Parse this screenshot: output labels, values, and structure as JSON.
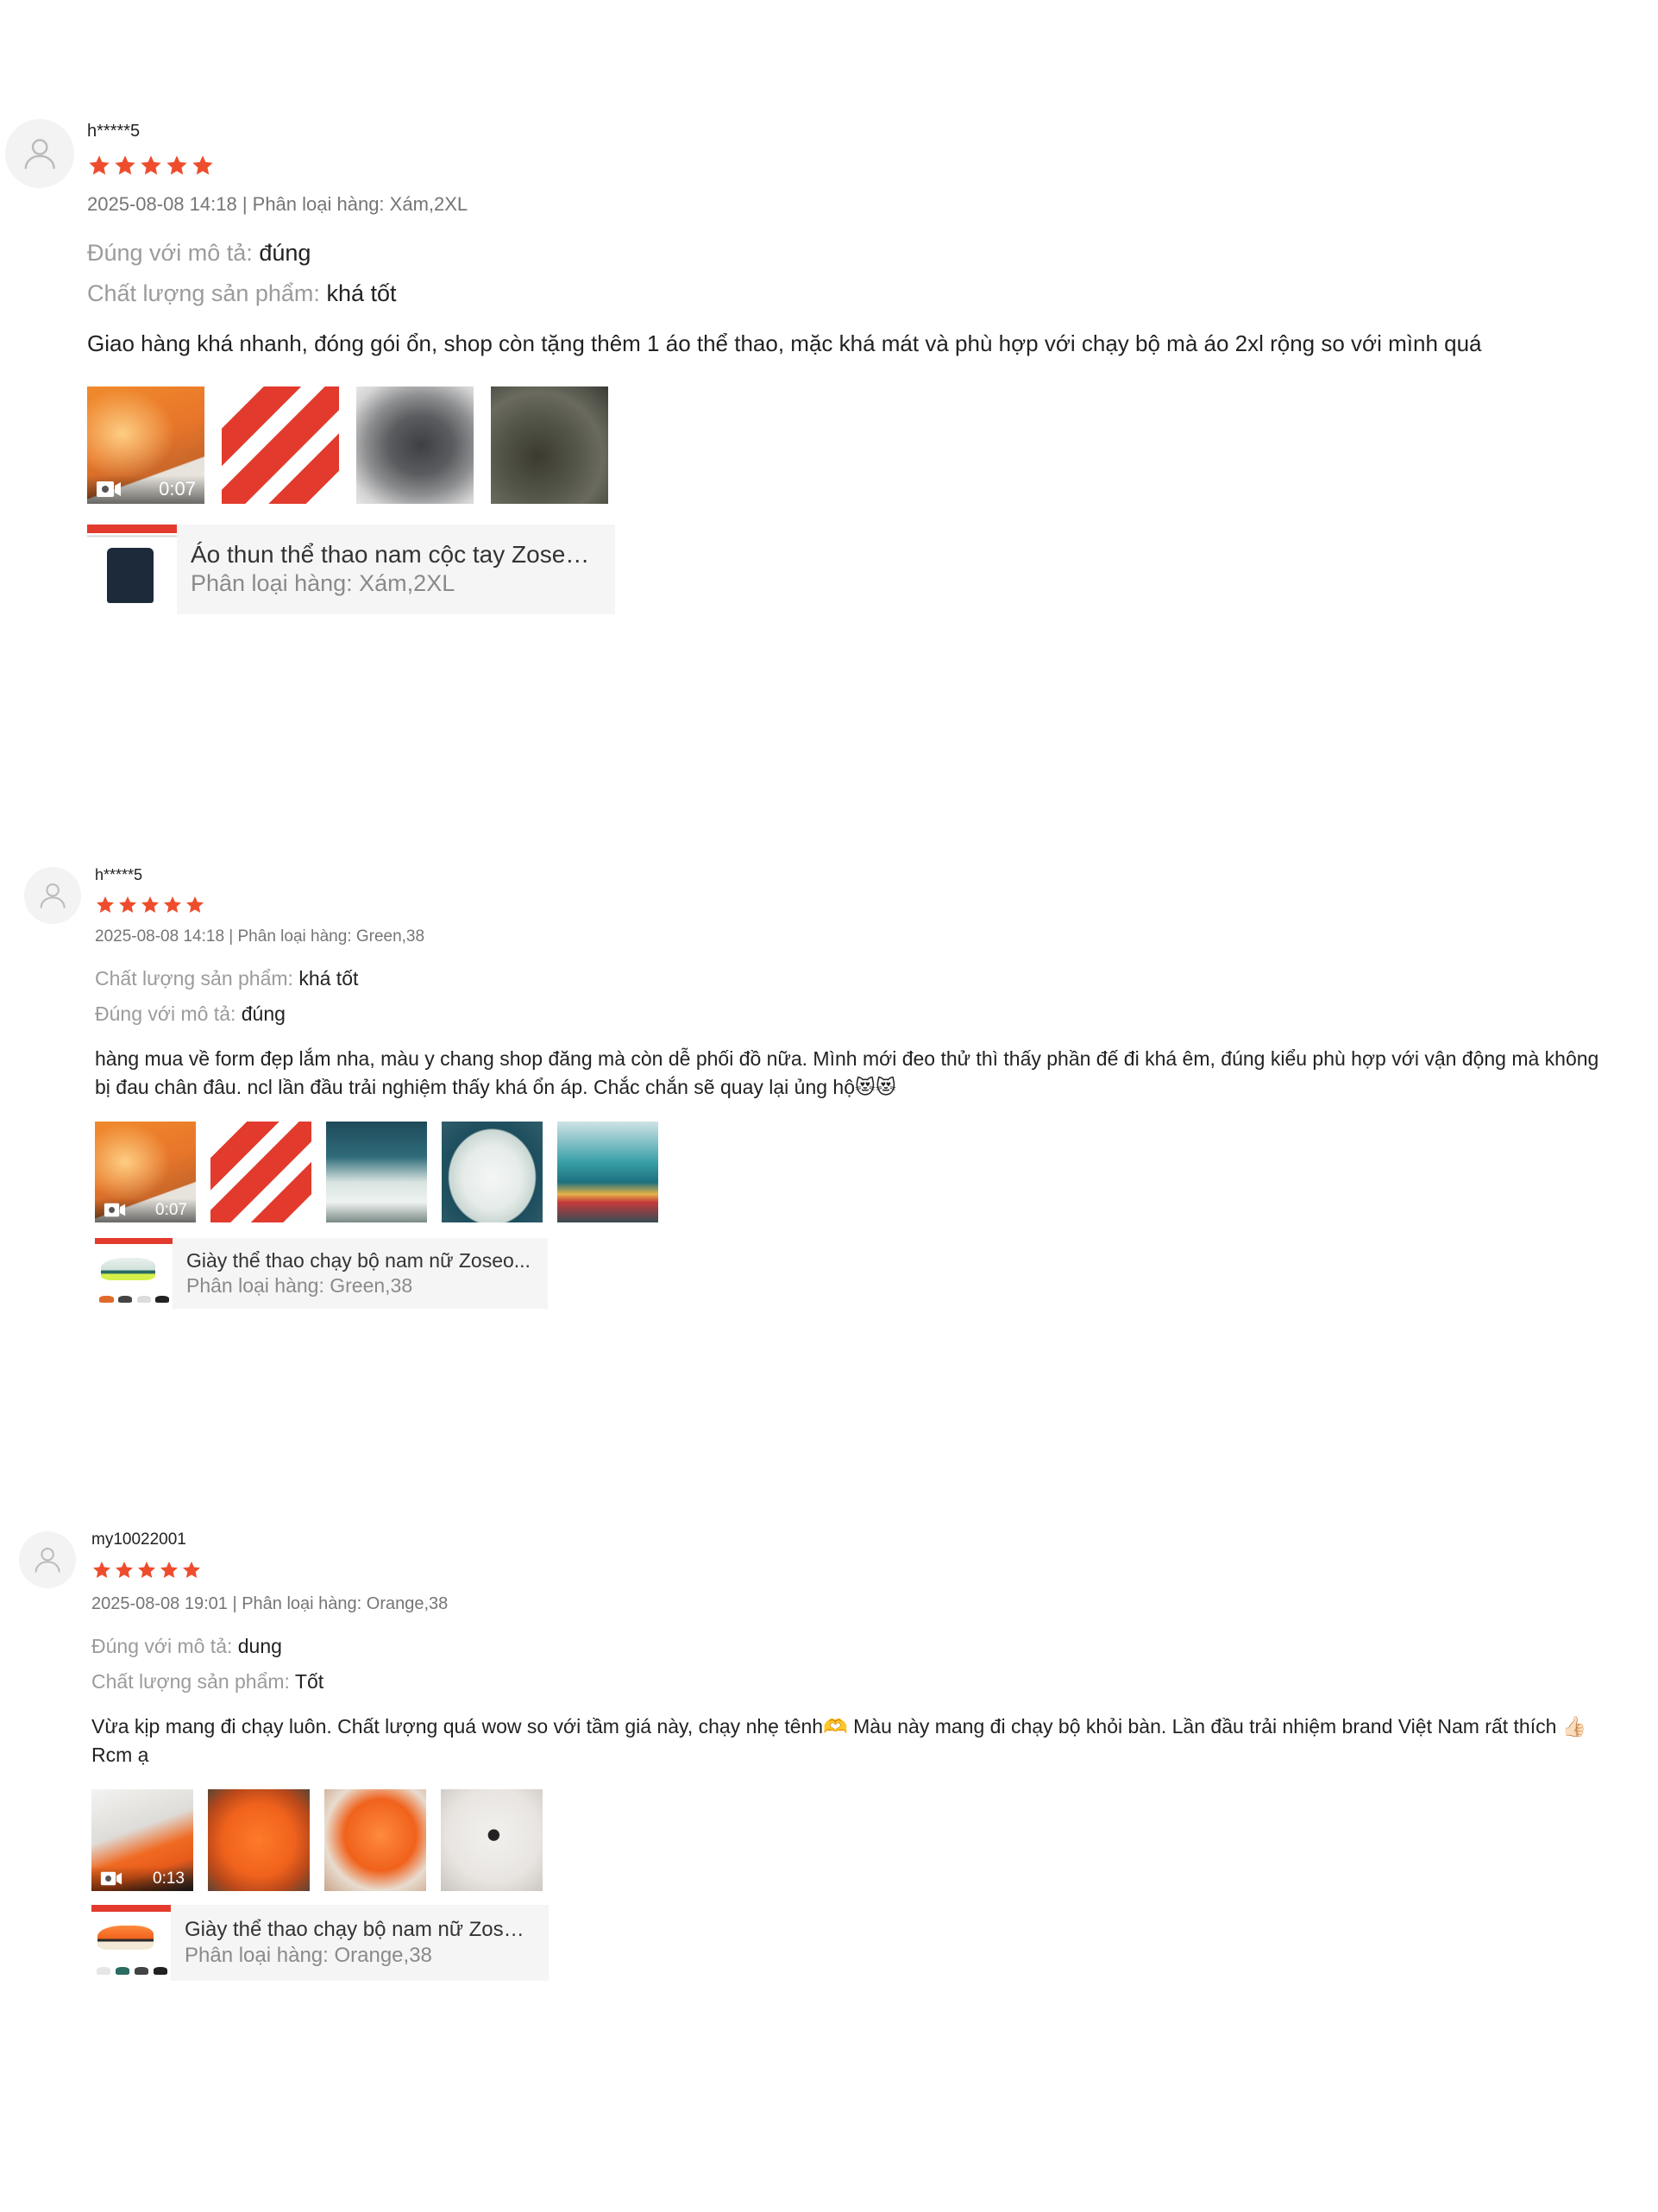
{
  "colors": {
    "star": "#ee4d2d",
    "meta_gray": "#757575",
    "label_gray": "#9b9b9b",
    "card_bg": "#f5f5f5",
    "avatar_bg": "#f3f3f3"
  },
  "reviews": [
    {
      "username": "h*****5",
      "rating": 5,
      "meta": "2025-08-08 14:18 | Phân loại hàng: Xám,2XL",
      "attributes": [
        {
          "label": "Đúng với mô tả:",
          "value": "đúng"
        },
        {
          "label": "Chất lượng sản phẩm:",
          "value": "khá tốt"
        }
      ],
      "comment": "Giao hàng khá nhanh, đóng gói ổn, shop còn tặng thêm 1 áo thể thao, mặc khá mát và phù hợp với chạy bộ mà áo 2xl rộng so với mình quá",
      "media": [
        {
          "type": "video",
          "duration": "0:07",
          "icon": "video-camera-icon"
        },
        {
          "type": "image"
        },
        {
          "type": "image"
        },
        {
          "type": "image"
        }
      ],
      "product": {
        "name": "Áo thun thể thao nam cộc tay Zoseo t...",
        "variation": "Phân loại hàng: Xám,2XL"
      }
    },
    {
      "username": "h*****5",
      "rating": 5,
      "meta": "2025-08-08 14:18 | Phân loại hàng: Green,38",
      "attributes": [
        {
          "label": "Chất lượng sản phẩm:",
          "value": "khá tốt"
        },
        {
          "label": "Đúng với mô tả:",
          "value": "đúng"
        }
      ],
      "comment": "hàng mua về form đẹp lắm nha, màu y chang shop đăng mà còn dễ phối đồ nữa. Mình mới đeo thử thì thấy phần đế đi khá êm, đúng kiểu phù hợp với vận động mà không bị đau chân đâu. ncl lần đầu trải nghiệm thấy khá ổn áp. Chắc chắn sẽ quay lại ủng hộ😻😻",
      "media": [
        {
          "type": "video",
          "duration": "0:07",
          "icon": "video-camera-icon"
        },
        {
          "type": "image"
        },
        {
          "type": "image"
        },
        {
          "type": "image"
        },
        {
          "type": "image"
        }
      ],
      "product": {
        "name": "Giày thể thao chạy bộ nam nữ Zoseo...",
        "variation": "Phân loại hàng: Green,38"
      }
    },
    {
      "username": "my10022001",
      "rating": 5,
      "meta": "2025-08-08 19:01 | Phân loại hàng: Orange,38",
      "attributes": [
        {
          "label": "Đúng với mô tả:",
          "value": "dung"
        },
        {
          "label": "Chất lượng sản phẩm:",
          "value": "Tốt"
        }
      ],
      "comment": "Vừa kịp mang đi chạy luôn. Chất lượng quá wow so với tầm giá này, chạy nhẹ tênh🫶 Màu này mang đi chạy bộ khỏi bàn. Lần đầu trải nhiệm brand Việt Nam rất thích 👍🏻 Rcm ạ",
      "media": [
        {
          "type": "video",
          "duration": "0:13",
          "icon": "video-camera-icon"
        },
        {
          "type": "image"
        },
        {
          "type": "image"
        },
        {
          "type": "image"
        }
      ],
      "product": {
        "name": "Giày thể thao chạy bộ nam nữ Zoseo...",
        "variation": "Phân loại hàng: Orange,38"
      }
    }
  ]
}
